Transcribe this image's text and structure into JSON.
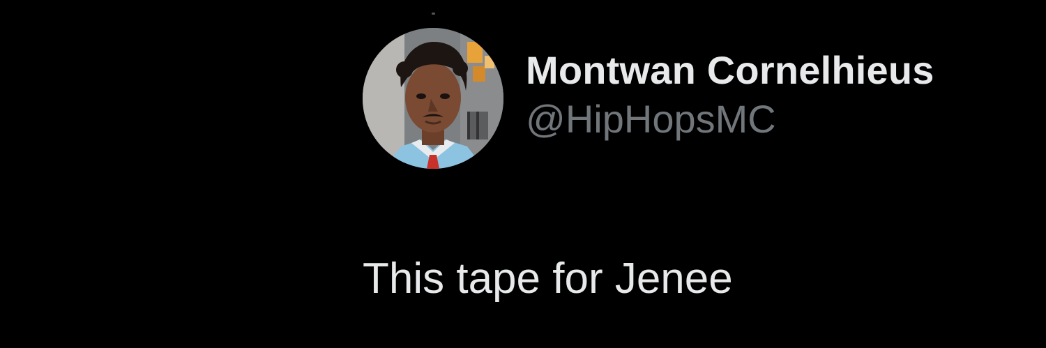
{
  "tweet": {
    "author": {
      "display_name": "Montwan Cornelhieus",
      "handle": "@HipHopsMC",
      "avatar_icon": "profile-photo"
    },
    "text": "This tape for Jenee"
  },
  "colors": {
    "background": "#000000",
    "primary_text": "#e7e9ea",
    "secondary_text": "#71767b"
  }
}
